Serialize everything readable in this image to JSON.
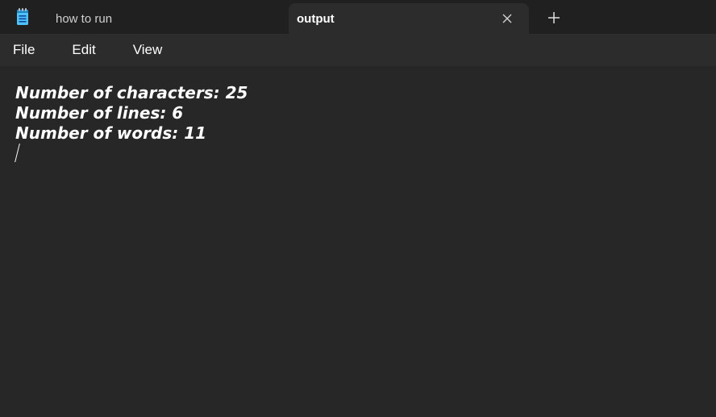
{
  "tabs": [
    {
      "label": "how to run",
      "active": false
    },
    {
      "label": "output",
      "active": true
    }
  ],
  "menu": {
    "file": "File",
    "edit": "Edit",
    "view": "View"
  },
  "editor": {
    "lines": [
      "Number of characters: 25",
      "Number of lines: 6",
      "Number of words: 11"
    ]
  },
  "icons": {
    "app": "notepad-icon",
    "close": "close-icon",
    "new_tab": "plus-icon"
  },
  "colors": {
    "background": "#272727",
    "titlebar": "#202020",
    "active_tab": "#2c2c2c",
    "accent": "#4fc3f7",
    "text": "#ffffff"
  }
}
